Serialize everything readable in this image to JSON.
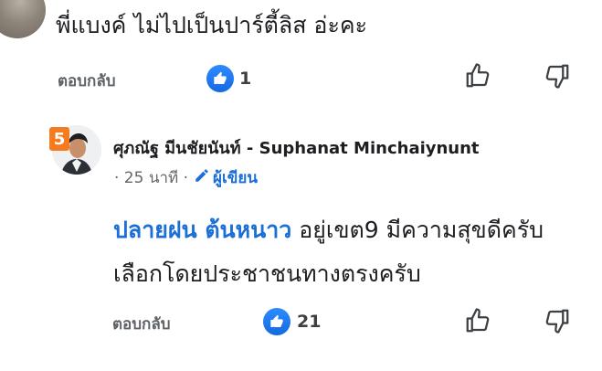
{
  "top_comment": {
    "text": "พี่แบงค์ ไม่ไปเป็นปาร์ตี้ลิส อ่ะคะ",
    "reply_label": "ตอบกลับ",
    "like_count": "1"
  },
  "reply": {
    "author": "ศุภณัฐ มีนชัยนันท์ - Suphanat Minchaiynunt",
    "time": "· 25 นาที ·",
    "author_badge": "ผู้เขียน",
    "mention": "ปลายฝน ต้นหนาว",
    "body": " อยู่เขต9 มีความสุขดีครับ เลือกโดยประชาชนทางตรงครับ",
    "reply_label": "ตอบกลับ",
    "like_count": "21",
    "avatar_badge": "5"
  },
  "colors": {
    "accent": "#1b6fd6",
    "like_blue": "#1877f2",
    "party_orange": "#f47b20"
  },
  "icons": [
    "thumbs-up-icon",
    "thumbs-down-icon",
    "pencil-icon",
    "like-badge-icon"
  ]
}
